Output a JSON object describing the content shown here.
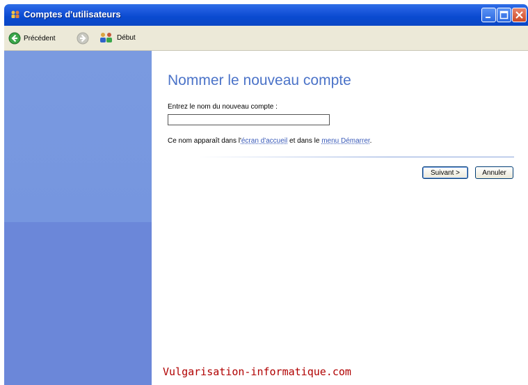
{
  "window": {
    "title": "Comptes d'utilisateurs",
    "controls": [
      "minimize-icon",
      "maximize-icon",
      "close-icon"
    ]
  },
  "toolbar": {
    "back_label": "Précédent",
    "home_label": "Début"
  },
  "main": {
    "heading": "Nommer le nouveau compte",
    "input_label": "Entrez le nom du nouveau compte :",
    "name_value": "",
    "info_prefix": "Ce nom apparaît dans l'",
    "info_link1": "écran d'accueil",
    "info_middle": " et dans le ",
    "info_link2": "menu Démarrer",
    "info_suffix": ".",
    "next_label": "Suivant >",
    "cancel_label": "Annuler"
  },
  "watermark": "Vulgarisation-informatique.com",
  "colors": {
    "titlebar": "#0b4ad0",
    "leftpane": "#7696df",
    "heading": "#4b73c8",
    "link": "#3859b8",
    "watermark": "#b00000"
  }
}
